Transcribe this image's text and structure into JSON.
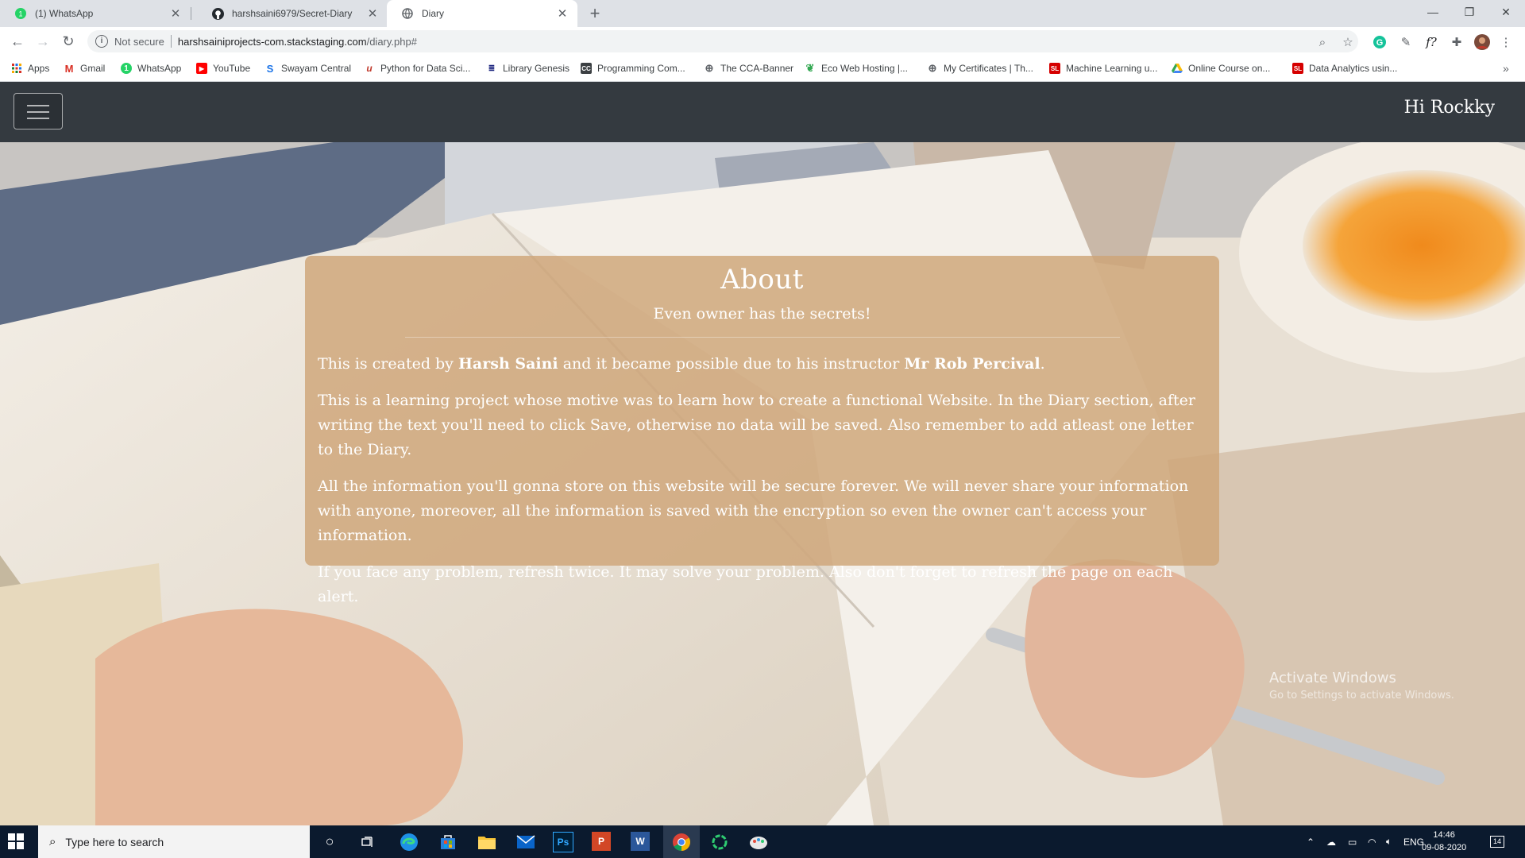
{
  "browser": {
    "tabs": [
      {
        "title": "(1) WhatsApp",
        "icon": "whatsapp-icon"
      },
      {
        "title": "harshsaini6979/Secret-Diary",
        "icon": "github-icon"
      },
      {
        "title": "Diary",
        "icon": "globe-icon"
      }
    ],
    "url": {
      "security": "Not secure",
      "host": "harshsainiprojects-com.stackstaging.com",
      "path": "/diary.php#"
    },
    "bookmarks": [
      {
        "label": "Apps",
        "icon": "apps-grid-icon"
      },
      {
        "label": "Gmail",
        "icon": "gmail-icon"
      },
      {
        "label": "WhatsApp",
        "icon": "whatsapp-icon"
      },
      {
        "label": "YouTube",
        "icon": "youtube-icon"
      },
      {
        "label": "Swayam Central",
        "icon": "swayam-icon"
      },
      {
        "label": "Python for Data Sci...",
        "icon": "python-course-icon"
      },
      {
        "label": "Library Genesis",
        "icon": "library-icon"
      },
      {
        "label": "Programming Com...",
        "icon": "programming-icon"
      },
      {
        "label": "The CCA-Banner",
        "icon": "globe-icon"
      },
      {
        "label": "Eco Web Hosting |...",
        "icon": "leaf-icon"
      },
      {
        "label": "My Certificates | Th...",
        "icon": "globe-icon"
      },
      {
        "label": "Machine Learning u...",
        "icon": "sl-icon"
      },
      {
        "label": "Online Course on...",
        "icon": "drive-icon"
      },
      {
        "label": "Data Analytics usin...",
        "icon": "sl-icon"
      }
    ]
  },
  "navbar": {
    "greeting": "Hi Rockky"
  },
  "about": {
    "title": "About",
    "subtitle": "Even owner has the secrets!",
    "p1_pre": "This is created by ",
    "p1_author": "Harsh Saini",
    "p1_mid": " and it became possible due to his instructor ",
    "p1_instructor": "Mr Rob Percival",
    "p1_end": ".",
    "p2": "This is a learning project whose motive was to learn how to create a functional Website. In the Diary section, after writing the text you'll need to click Save, otherwise no data will be saved. Also remember to add atleast one letter to the Diary.",
    "p3": "All the information you'll gonna store on this website will be secure forever. We will never share your information with anyone, moreover, all the information is saved with the encryption so even the owner can't access your information.",
    "p4": "If you face any problem, refresh twice. It may solve your problem. Also don't forget to refresh the page on each alert."
  },
  "watermark": {
    "line1": "Activate Windows",
    "line2": "Go to Settings to activate Windows."
  },
  "taskbar": {
    "search_placeholder": "Type here to search",
    "apps": [
      "cortana-icon",
      "task-view-icon",
      "edge-icon",
      "store-icon",
      "file-explorer-icon",
      "mail-icon",
      "photoshop-icon",
      "powerpoint-icon",
      "word-icon",
      "chrome-icon",
      "loading-ring-icon",
      "paint-icon"
    ],
    "ps": "Ps",
    "ppt": "P",
    "word": "W",
    "lang": "ENG",
    "time": "14:46",
    "date": "09-08-2020",
    "notif_count": "14"
  },
  "colors": {
    "navbar_bg": "#343a40",
    "card_bg": "#cea578"
  }
}
